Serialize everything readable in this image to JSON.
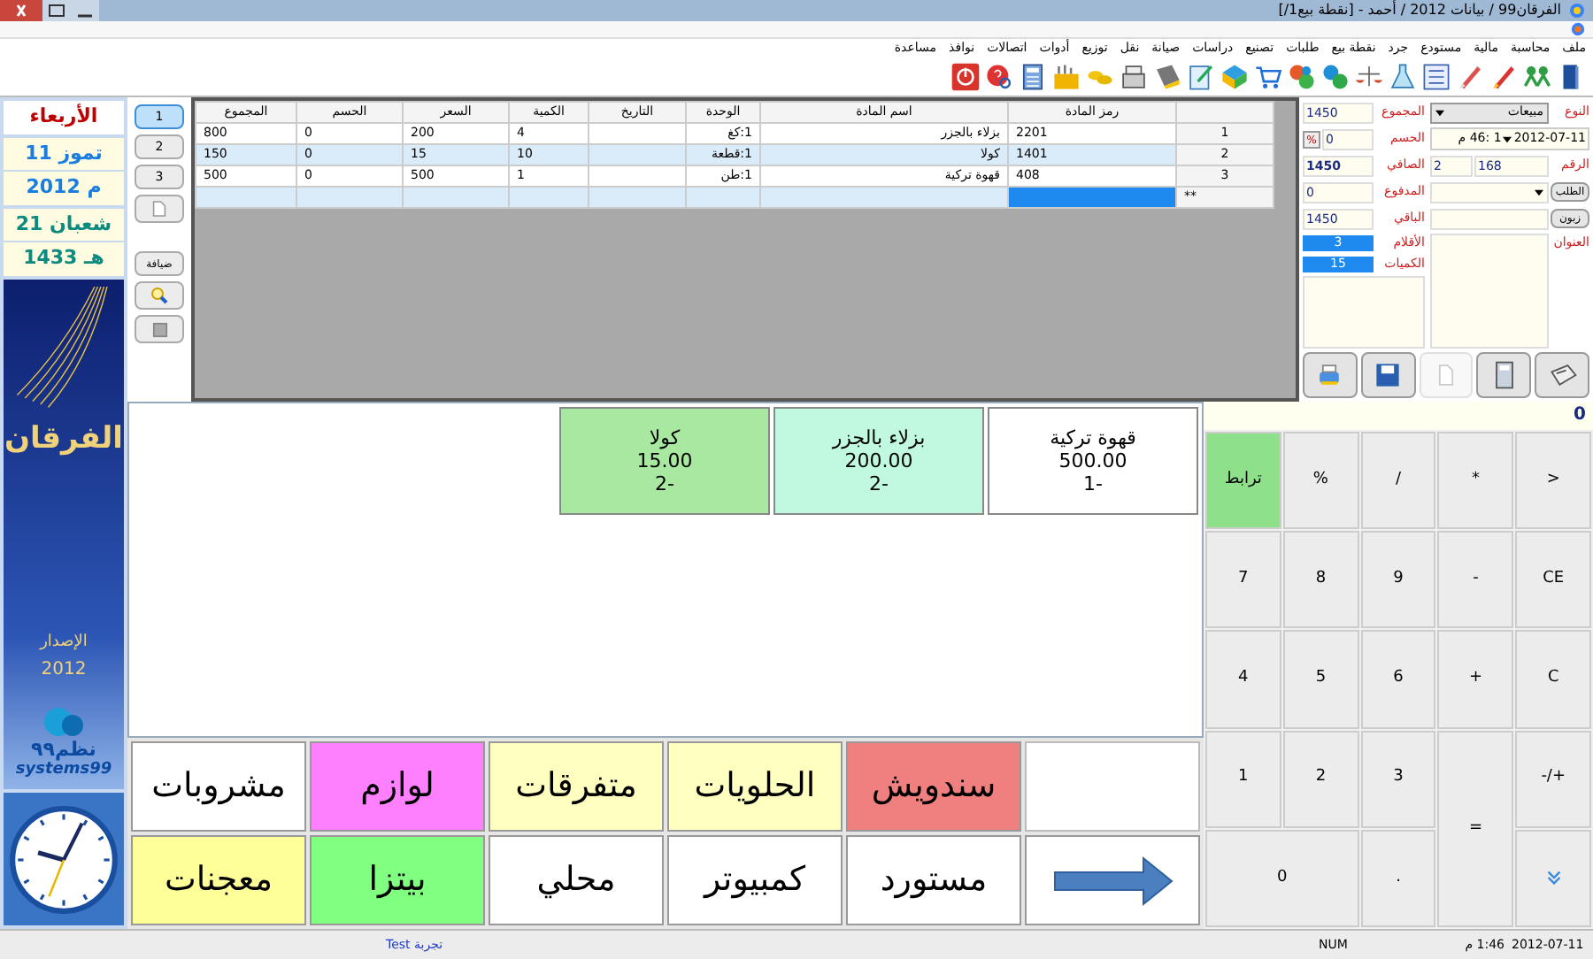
{
  "window": {
    "title": "الفرقان99 / بيانات 2012 / أحمد - [نقطة بيع1/]"
  },
  "menu": [
    "ملف",
    "محاسبة",
    "مالية",
    "مستودع",
    "جرد",
    "نقطة بيع",
    "طلبات",
    "تصنيع",
    "دراسات",
    "صيانة",
    "نقل",
    "توزيع",
    "أدوات",
    "اتصالات",
    "نوافذ",
    "مساعدة"
  ],
  "date_panel": {
    "weekday": "الأربعاء",
    "gregorian_day": "11 تموز",
    "gregorian_year": "2012 م",
    "hijri_day": "21 شعبان",
    "hijri_year": "1433 هـ"
  },
  "logo": {
    "name": "الفرقان",
    "edition_label": "الإصدار",
    "edition_year": "2012",
    "brand": "نظم٩٩",
    "brand_latin": "systems99"
  },
  "invoice_tabs": [
    {
      "label": "1",
      "selected": true
    },
    {
      "label": "2",
      "selected": false
    },
    {
      "label": "3",
      "selected": false
    }
  ],
  "hospitality_button": "ضيافة",
  "table": {
    "columns": [
      "رمز المادة",
      "اسم المادة",
      "الوحدة",
      "التاريخ",
      "الكمية",
      "السعر",
      "الحسم",
      "المجموع"
    ],
    "rows": [
      {
        "number": "1",
        "code": "2201",
        "name": "بزلاء بالجزر",
        "unit": "1:كغ",
        "quantity": "4",
        "price": "200",
        "discount": "0",
        "total": "800",
        "selected": false
      },
      {
        "number": "2",
        "code": "1401",
        "name": "كولا",
        "unit": "1:قطعة",
        "quantity": "10",
        "price": "15",
        "discount": "0",
        "total": "150",
        "selected": true
      },
      {
        "number": "3",
        "code": "408",
        "name": "قهوة تركية",
        "unit": "1:طن",
        "quantity": "1",
        "price": "500",
        "discount": "0",
        "total": "500",
        "selected": false
      }
    ],
    "new_row_marker": "**"
  },
  "invoice_form": {
    "type_label": "النوع",
    "type_value": "مبيعات",
    "date": "2012-07-11",
    "time": "1 :46 م",
    "number_label": "الرقم",
    "number": "168",
    "number_suffix": "2",
    "order_button": "الطلب",
    "customer_button": "زبون",
    "address_label": "العنوان",
    "total_label": "المجموع",
    "total": "1450",
    "discount_label": "الحسم",
    "discount": "0",
    "discount_button": "%",
    "net_label": "الصافي",
    "net": "1450",
    "paid_label": "المدفوع",
    "paid": "0",
    "remaining_label": "الباقي",
    "remaining": "1450",
    "items_label": "الأقلام",
    "items": "3",
    "quantities_label": "الكميات",
    "quantities": "15"
  },
  "actions": [
    {
      "kind": "register",
      "disabled": false
    },
    {
      "kind": "calculator",
      "disabled": false
    },
    {
      "kind": "new",
      "disabled": true
    },
    {
      "kind": "save",
      "disabled": false
    },
    {
      "kind": "print",
      "disabled": false
    }
  ],
  "products": [
    {
      "name": "قهوة تركية",
      "price": "500.00",
      "quantity": "1-",
      "color": "#ffffff"
    },
    {
      "name": "بزلاء بالجزر",
      "price": "200.00",
      "quantity": "2-",
      "color": "#c0f8e0"
    },
    {
      "name": "كولا",
      "price": "15.00",
      "quantity": "2-",
      "color": "#a8e8a0"
    }
  ],
  "categories": [
    {
      "kind": "blank"
    },
    {
      "kind": "category",
      "label": "سندويش",
      "color": "#f08080"
    },
    {
      "kind": "category",
      "label": "الحلويات",
      "color": "#ffffc0"
    },
    {
      "kind": "category",
      "label": "متفرقات",
      "color": "#ffffc0"
    },
    {
      "kind": "category",
      "label": "لوازم",
      "color": "#ff80ff"
    },
    {
      "kind": "category",
      "label": "مشروبات",
      "color": "#ffffff"
    },
    {
      "kind": "next"
    },
    {
      "kind": "category",
      "label": "مستورد",
      "color": "#ffffff"
    },
    {
      "kind": "category",
      "label": "كمبيوتر",
      "color": "#ffffff"
    },
    {
      "kind": "category",
      "label": "محلي",
      "color": "#ffffff"
    },
    {
      "kind": "category",
      "label": "بيتزا",
      "color": "#80ff80"
    },
    {
      "kind": "category",
      "label": "معجنات",
      "color": "#ffff99"
    }
  ],
  "calculator": {
    "display": "0",
    "keys": [
      {
        "kind": "key",
        "label": ">"
      },
      {
        "kind": "key",
        "label": "*"
      },
      {
        "kind": "key",
        "label": "/"
      },
      {
        "kind": "key",
        "label": "%"
      },
      {
        "kind": "link",
        "label": "ترابط"
      },
      {
        "kind": "key",
        "label": "CE"
      },
      {
        "kind": "key",
        "label": "-"
      },
      {
        "kind": "key",
        "label": "9"
      },
      {
        "kind": "key",
        "label": "8"
      },
      {
        "kind": "key",
        "label": "7"
      },
      {
        "kind": "key",
        "label": "C"
      },
      {
        "kind": "key",
        "label": "+"
      },
      {
        "kind": "key",
        "label": "6"
      },
      {
        "kind": "key",
        "label": "5"
      },
      {
        "kind": "key",
        "label": "4"
      },
      {
        "kind": "key",
        "label": "-/+"
      },
      {
        "kind": "tall",
        "label": "="
      },
      {
        "kind": "key",
        "label": "3"
      },
      {
        "kind": "key",
        "label": "2"
      },
      {
        "kind": "key",
        "label": "1"
      },
      {
        "kind": "down"
      },
      {
        "kind": "key",
        "label": "."
      },
      {
        "kind": "wide",
        "label": "0"
      }
    ]
  },
  "status_bar": {
    "note": "تجربة Test",
    "num": "NUM",
    "time": "1:46 م",
    "date": "2012-07-11"
  }
}
